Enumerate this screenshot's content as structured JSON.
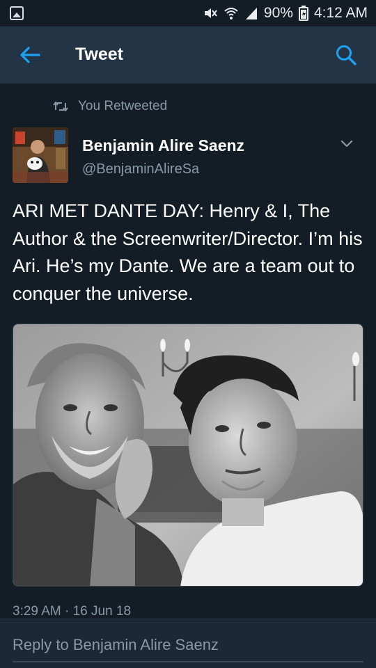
{
  "status_bar": {
    "battery": "90%",
    "time": "4:12 AM",
    "icons": [
      "gallery-icon",
      "mute-icon",
      "wifi-icon",
      "signal-icon",
      "battery-icon"
    ]
  },
  "app_bar": {
    "title": "Tweet",
    "icons": [
      "back-arrow-icon",
      "search-icon"
    ],
    "accent_color": "#1da1f2"
  },
  "retweet_context": {
    "label": "You Retweeted",
    "icon": "retweet-icon"
  },
  "author": {
    "name": "Benjamin Alire Saenz",
    "handle": "@BenjaminAlireSa",
    "icon": "chevron-down-icon"
  },
  "tweet": {
    "text": "ARI MET DANTE DAY: Henry & I, The Author & the Screenwriter/Director. I’m his Ari. He’s my Dante. We are a team out to conquer the universe.",
    "timestamp": "3:29 AM · 16 Jun 18"
  },
  "reply": {
    "placeholder": "Reply to Benjamin Alire Saenz"
  },
  "colors": {
    "background": "#141d26",
    "app_bar": "#243447",
    "muted_text": "#8899a6"
  }
}
